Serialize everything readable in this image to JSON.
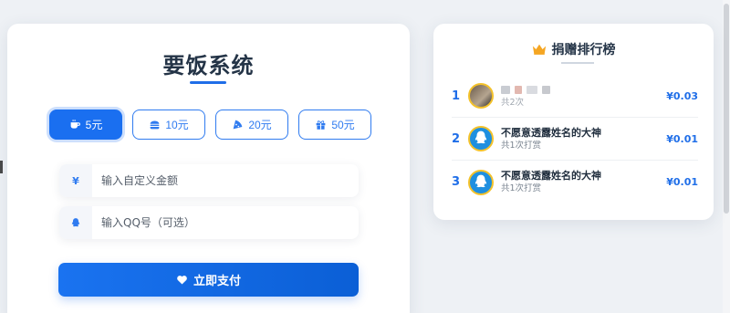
{
  "pay_card": {
    "title": "要饭系统",
    "amounts": [
      {
        "label": "5元",
        "icon": "coffee-icon",
        "active": true
      },
      {
        "label": "10元",
        "icon": "burger-icon",
        "active": false
      },
      {
        "label": "20元",
        "icon": "pizza-icon",
        "active": false
      },
      {
        "label": "50元",
        "icon": "gift-icon",
        "active": false
      }
    ],
    "custom_amount": {
      "prefix": "¥",
      "placeholder": "输入自定义金额",
      "value": ""
    },
    "qq_field": {
      "icon": "qq-icon",
      "placeholder": "输入QQ号（可选）",
      "value": ""
    },
    "pay_button": {
      "label": "立即支付",
      "icon": "heart-icon"
    }
  },
  "leaderboard": {
    "title": "捐赠排行榜",
    "icon": "crown-icon",
    "entries": [
      {
        "rank": "1",
        "name": "",
        "name_blurred": true,
        "sub": "共2次",
        "amount": "¥0.03",
        "avatar": "photo"
      },
      {
        "rank": "2",
        "name": "不愿意透露姓名的大神",
        "sub": "共1次打赏",
        "amount": "¥0.01",
        "avatar": "qq-penguin"
      },
      {
        "rank": "3",
        "name": "不愿意透露姓名的大神",
        "sub": "共1次打赏",
        "amount": "¥0.01",
        "avatar": "qq-penguin"
      }
    ]
  },
  "colors": {
    "accent": "#1a6ff0",
    "rank_accent": "#1f6ee8",
    "avatar_ring": "#f4c22b",
    "crown": "#f5a623",
    "page_bg": "#eef1f5"
  }
}
